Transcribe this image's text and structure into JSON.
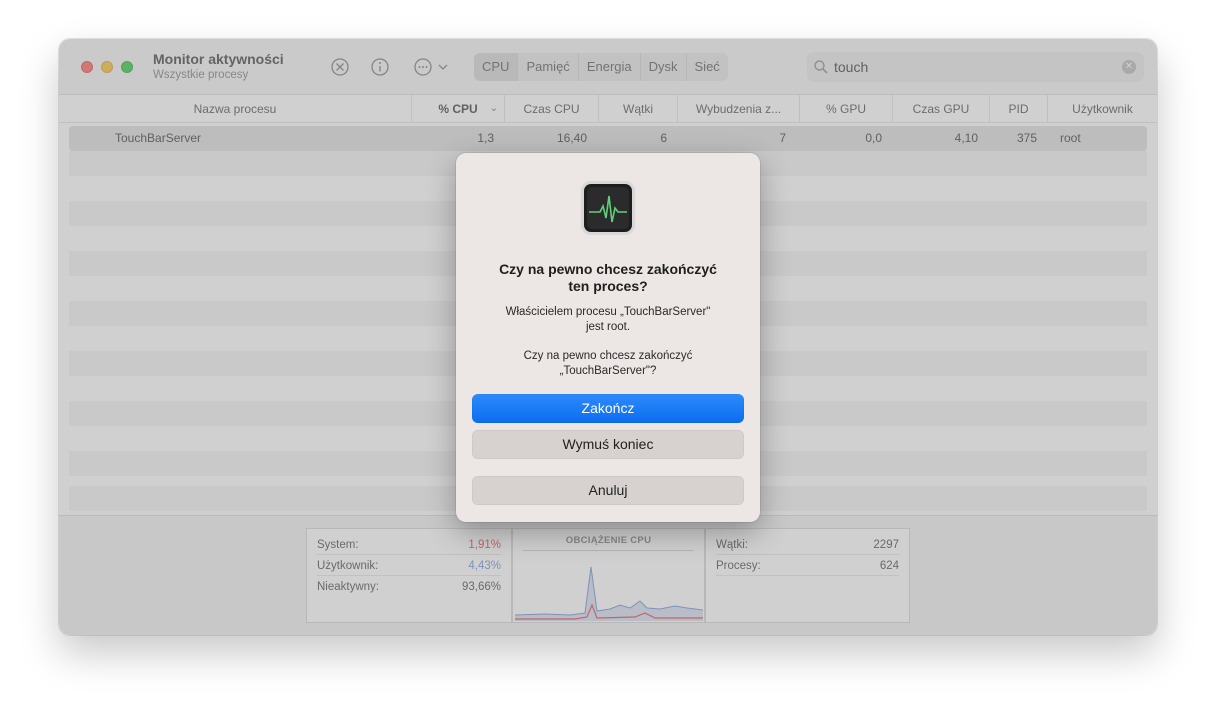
{
  "window": {
    "title": "Monitor aktywności",
    "subtitle": "Wszystkie procesy"
  },
  "toolbar": {
    "icons": [
      "stop-process-icon",
      "info-icon",
      "more-options-icon"
    ],
    "tabs": [
      "CPU",
      "Pamięć",
      "Energia",
      "Dysk",
      "Sieć"
    ],
    "active_tab": "CPU",
    "search": {
      "value": "touch",
      "placeholder": "Szukaj"
    }
  },
  "table": {
    "columns": [
      "Nazwa procesu",
      "% CPU",
      "Czas CPU",
      "Wątki",
      "Wybudzenia z...",
      "% GPU",
      "Czas GPU",
      "PID",
      "Użytkownik"
    ],
    "rows": [
      {
        "name": "TouchBarServer",
        "cpu": "1,3",
        "cpu_time": "16,40",
        "threads": "6",
        "wakeups": "7",
        "gpu": "0,0",
        "gpu_time": "4,10",
        "pid": "375",
        "user": "root"
      }
    ]
  },
  "stats": {
    "left": [
      {
        "label": "System:",
        "value": "1,91%"
      },
      {
        "label": "Użytkownik:",
        "value": "4,43%"
      },
      {
        "label": "Nieaktywny:",
        "value": "93,66%"
      }
    ],
    "graph_title": "OBCIĄŻENIE CPU",
    "right": [
      {
        "label": "Wątki:",
        "value": "2297"
      },
      {
        "label": "Procesy:",
        "value": "624"
      }
    ],
    "colors": {
      "system": "#e04040",
      "user": "#6b8fd6"
    }
  },
  "dialog": {
    "title_line1": "Czy na pewno chcesz zakończyć",
    "title_line2": "ten proces?",
    "owner_line1": "Właścicielem procesu „TouchBarServer\"",
    "owner_line2": "jest root.",
    "confirm_line1": "Czy na pewno chcesz zakończyć",
    "confirm_line2": "„TouchBarServer\"?",
    "buttons": {
      "quit": "Zakończ",
      "force_quit": "Wymuś koniec",
      "cancel": "Anuluj"
    }
  }
}
